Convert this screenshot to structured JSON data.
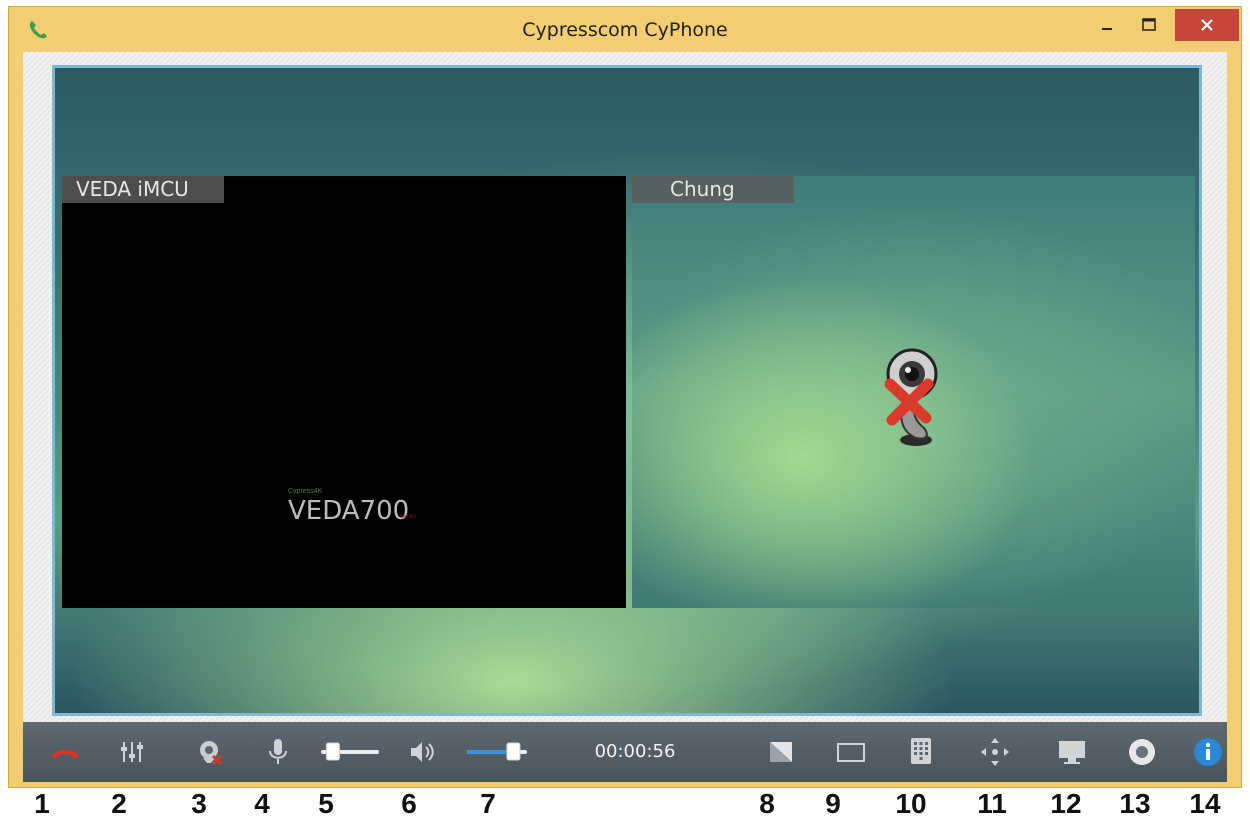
{
  "window": {
    "title": "Cypresscom CyPhone",
    "icons": {
      "app": "phone-icon",
      "minimize": "minimize-icon",
      "maximize": "maximize-icon",
      "close": "close-icon"
    }
  },
  "video": {
    "left_pane": {
      "label": "VEDA iMCU",
      "logo_small": "Cypress4K",
      "logo_main": "VEDA700",
      "logo_suffix": "series"
    },
    "right_pane": {
      "label": "Chung",
      "icon": "webcam-off-icon"
    }
  },
  "toolbar": {
    "timer": "00:00:56",
    "mic_level": 0.12,
    "speaker_level": 0.85,
    "icons": [
      "hangup-icon",
      "settings-sliders-icon",
      "camera-off-icon",
      "microphone-icon",
      "mic-volume-slider",
      "speaker-icon",
      "speaker-volume-slider",
      "layout-split-icon",
      "single-view-icon",
      "dialpad-icon",
      "move-icon",
      "screen-share-icon",
      "record-icon",
      "info-icon"
    ]
  },
  "callouts": [
    "1",
    "2",
    "3",
    "4",
    "5",
    "6",
    "7",
    "8",
    "9",
    "10",
    "11",
    "12",
    "13",
    "14"
  ],
  "colors": {
    "frame": "#f3cd72",
    "close_button": "#c7463b",
    "toolbar": "#4f5a61",
    "slider_accent": "#3a8fd9",
    "hangup": "#d9352a",
    "info": "#2a88d8"
  }
}
